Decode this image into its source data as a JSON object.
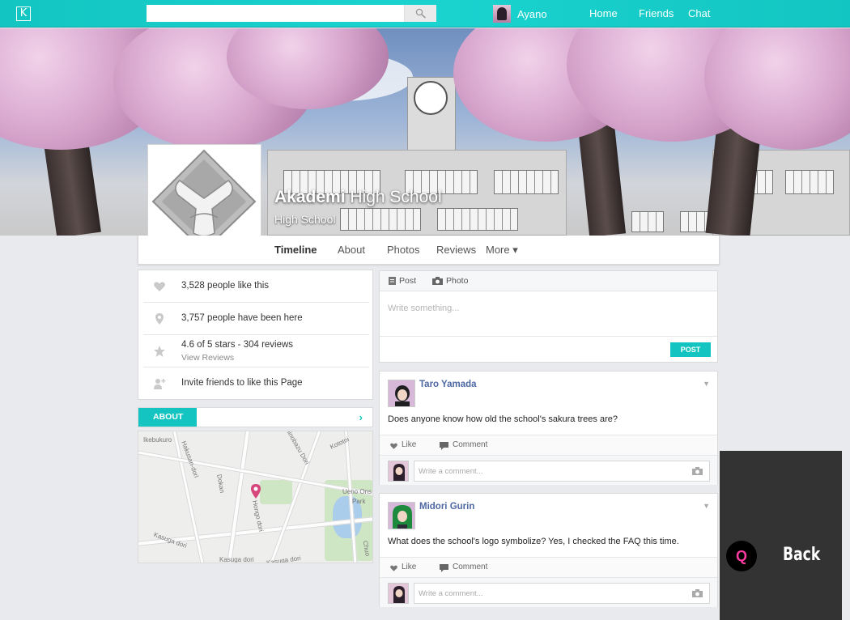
{
  "topbar": {
    "logo_letter": "K",
    "search_placeholder": "",
    "user_name": "Ayano",
    "nav": [
      "Home",
      "Friends",
      "Chat"
    ]
  },
  "page": {
    "name_bold": "Akademi",
    "name_rest": " High School",
    "category": "High School",
    "tabs": [
      "Timeline",
      "About",
      "Photos",
      "Reviews",
      "More ▾"
    ]
  },
  "info": {
    "likes": "3,528 people like this",
    "visits": "3,757 people have been here",
    "rating": "4.6 of 5 stars - 304 reviews",
    "view_reviews": "View Reviews",
    "invite": "Invite friends to like this Page"
  },
  "about": {
    "label": "ABOUT",
    "chevron": "›"
  },
  "map": {
    "labels": [
      "Hakusan-dori",
      "Kasuga dori",
      "Kasuga dori",
      "Kasuga dori",
      "Hongo dori",
      "Shinobazu Dori",
      "Ueno Ons",
      "Park",
      "Dokan",
      "Kototoi",
      "Chuo",
      "Ikebukuro"
    ]
  },
  "composer": {
    "post_tab": "Post",
    "photo_tab": "Photo",
    "placeholder": "Write something...",
    "button": "POST"
  },
  "posts": [
    {
      "author": "Taro Yamada",
      "text": "Does anyone know how old the school's sakura trees are?",
      "like": "Like",
      "comment": "Comment",
      "comment_placeholder": "Write a comment..."
    },
    {
      "author": "Midori Gurin",
      "text": "What does the school's logo symbolize? Yes, I checked the FAQ this time.",
      "like": "Like",
      "comment": "Comment",
      "comment_placeholder": "Write a comment..."
    }
  ],
  "back": {
    "key": "Q",
    "label": "Back"
  },
  "colors": {
    "accent": "#14c4c1",
    "link": "#4e69a2",
    "back_key": "#ff3ba0"
  }
}
